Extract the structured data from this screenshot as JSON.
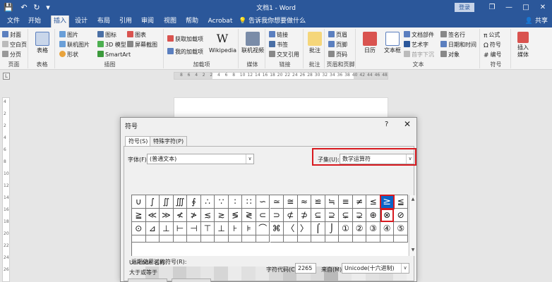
{
  "titlebar": {
    "title": "文档1 - Word",
    "login": "登录",
    "restore_glyph": "❐",
    "minimize_glyph": "—",
    "maximize_glyph": "□",
    "close_glyph": "✕",
    "qa_save": "💾",
    "qa_undo": "↶",
    "qa_redo": "↻",
    "qa_more": "▾"
  },
  "tabs": [
    {
      "label": "文件"
    },
    {
      "label": "开始"
    },
    {
      "label": "插入"
    },
    {
      "label": "设计"
    },
    {
      "label": "布局"
    },
    {
      "label": "引用"
    },
    {
      "label": "审阅"
    },
    {
      "label": "视图"
    },
    {
      "label": "帮助"
    },
    {
      "label": "Acrobat"
    },
    {
      "label": "告诉我你想要做什么"
    }
  ],
  "share": "共享",
  "ribbon": {
    "pages": {
      "cover": "封面",
      "blank": "空白页",
      "break": "分页",
      "label": "页面"
    },
    "tables": {
      "table": "表格",
      "label": "表格"
    },
    "illustrations": {
      "pictures": "图片",
      "online_pictures": "联机图片",
      "shapes": "形状",
      "icons": "图标",
      "model3d": "3D 模型",
      "smartart": "SmartArt",
      "chart": "图表",
      "screenshot": "屏幕截图",
      "label": "插图"
    },
    "addins": {
      "get": "获取加载项",
      "my": "我的加载项",
      "wikipedia": "Wikipedia",
      "label": "加载项"
    },
    "media": {
      "online_video": "联机视频",
      "label": "媒体"
    },
    "links": {
      "link": "链接",
      "bookmark": "书签",
      "crossref": "交叉引用",
      "label": "链接"
    },
    "comments": {
      "comment": "批注",
      "label": "批注"
    },
    "header_footer": {
      "header": "页眉",
      "footer": "页脚",
      "page_number": "页码",
      "label": "页眉和页脚"
    },
    "text": {
      "calendar": "日历",
      "date_time": "日期和时间",
      "textbox": "文本框",
      "parts": "文档部件",
      "wordart": "艺术字",
      "dropcap": "首字下沉",
      "signature": "签名行",
      "datetime2": "日期和时间",
      "object": "对象",
      "label": "文本"
    },
    "symbols": {
      "equation": "公式",
      "symbol": "符号",
      "number": "编号",
      "label": "符号"
    },
    "insert_media": {
      "label1": "插入",
      "label2": "媒体"
    }
  },
  "ruler_nums": [
    "8",
    "6",
    "4",
    "2",
    "2",
    "4",
    "6",
    "8",
    "10",
    "12",
    "14",
    "16",
    "18",
    "20",
    "22",
    "24",
    "26",
    "28",
    "30",
    "32",
    "34",
    "36",
    "38",
    "40",
    "42",
    "44",
    "46",
    "48"
  ],
  "vruler_nums": [
    "4",
    "2",
    "2",
    "4",
    "6",
    "8",
    "10",
    "12",
    "14",
    "16",
    "18",
    "20",
    "22",
    "24",
    "26"
  ],
  "dialog": {
    "title": "符号",
    "help": "?",
    "close": "✕",
    "tab_symbols": "符号(S)",
    "tab_special": "特殊字符(P)",
    "font_label": "字体(F):",
    "font_value": "(普通文本)",
    "subset_label": "子集(U):",
    "subset_value": "数学运算符",
    "symbols": [
      [
        "∪",
        "∫",
        "∬",
        "∭",
        "∮",
        "∴",
        "∵",
        "∶",
        "∷",
        "∽",
        "≃",
        "≅",
        "≈",
        "≌",
        "≒",
        "≡",
        "≠",
        "≤",
        "≥",
        "≦"
      ],
      [
        "≧",
        "≪",
        "≫",
        "≮",
        "≯",
        "≲",
        "≳",
        "≶",
        "≷",
        "⊂",
        "⊃",
        "⊄",
        "⊅",
        "⊆",
        "⊇",
        "⊊",
        "⊋",
        "⊕",
        "⊗",
        "⊘"
      ],
      [
        "⊙",
        "⊿",
        "⊥",
        "⊢",
        "⊣",
        "⊤",
        "⊥",
        "⊦",
        "⊧",
        "⌒",
        "⌘",
        "〈",
        "〉",
        "⌠",
        "⌡",
        "①",
        "②",
        "③",
        "④",
        "⑤"
      ]
    ],
    "selected_symbol": "≥",
    "recent_label": "近期使用过的符号(R):",
    "unicode_name_label": "Unicode 名称:",
    "unicode_name_value": "大于或等于",
    "charcode_label": "字符代码(C):",
    "charcode_value": "2265",
    "from_label": "来自(M):",
    "from_value": "Unicode(十六进制)",
    "arrow": "∨",
    "scroll_up": "▲",
    "scroll_down": "▼"
  }
}
